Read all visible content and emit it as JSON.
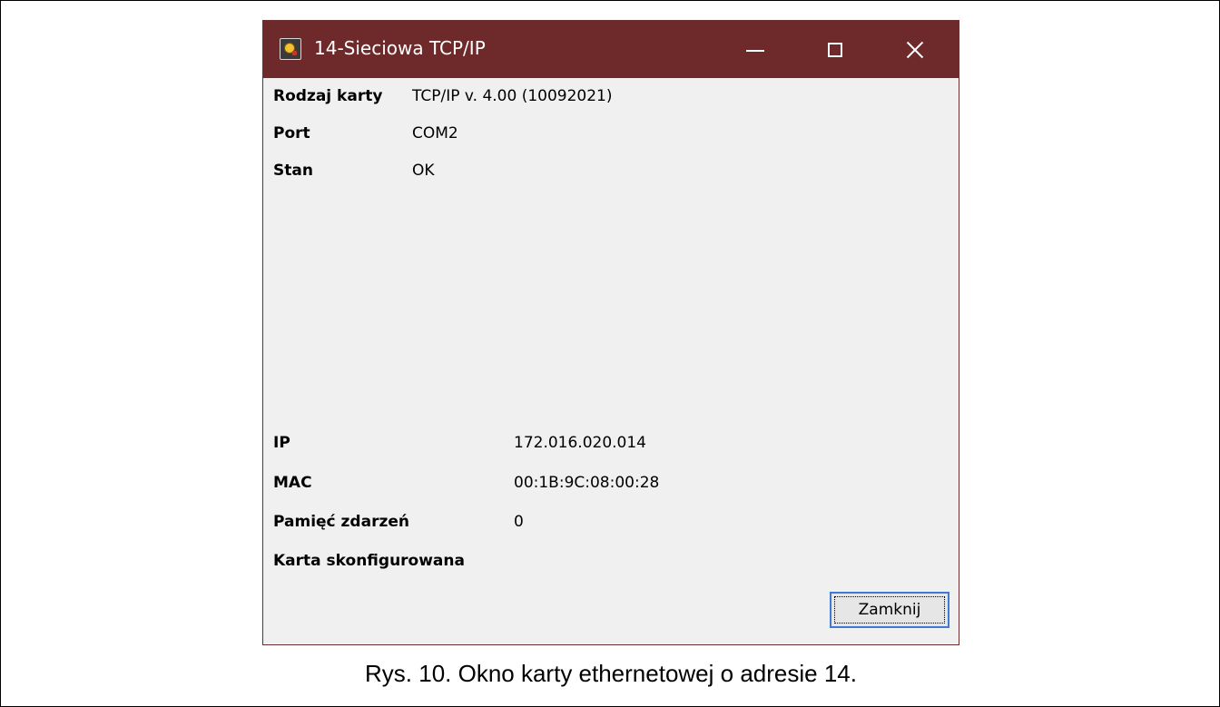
{
  "window": {
    "title": "14-Sieciowa TCP/IP",
    "icon": "app-icon",
    "controls": {
      "minimize": "minimize-icon",
      "maximize": "maximize-icon",
      "close": "close-icon"
    }
  },
  "info": {
    "card_type_label": "Rodzaj karty",
    "card_type_value": "TCP/IP v. 4.00 (10092021)",
    "port_label": "Port",
    "port_value": "COM2",
    "status_label": "Stan",
    "status_value": "OK"
  },
  "network": {
    "ip_label": "IP",
    "ip_value": "172.016.020.014",
    "mac_label": "MAC",
    "mac_value": "00:1B:9C:08:00:28",
    "memory_label": "Pamięć zdarzeń",
    "memory_value": "0",
    "configured_label": "Karta skonfigurowana"
  },
  "buttons": {
    "close_label": "Zamknij"
  },
  "caption": "Rys. 10. Okno karty ethernetowej o adresie 14.",
  "colors": {
    "titlebar": "#6e2a2a",
    "window_bg": "#f0f0f0",
    "focus_border": "#3d7bd6"
  }
}
